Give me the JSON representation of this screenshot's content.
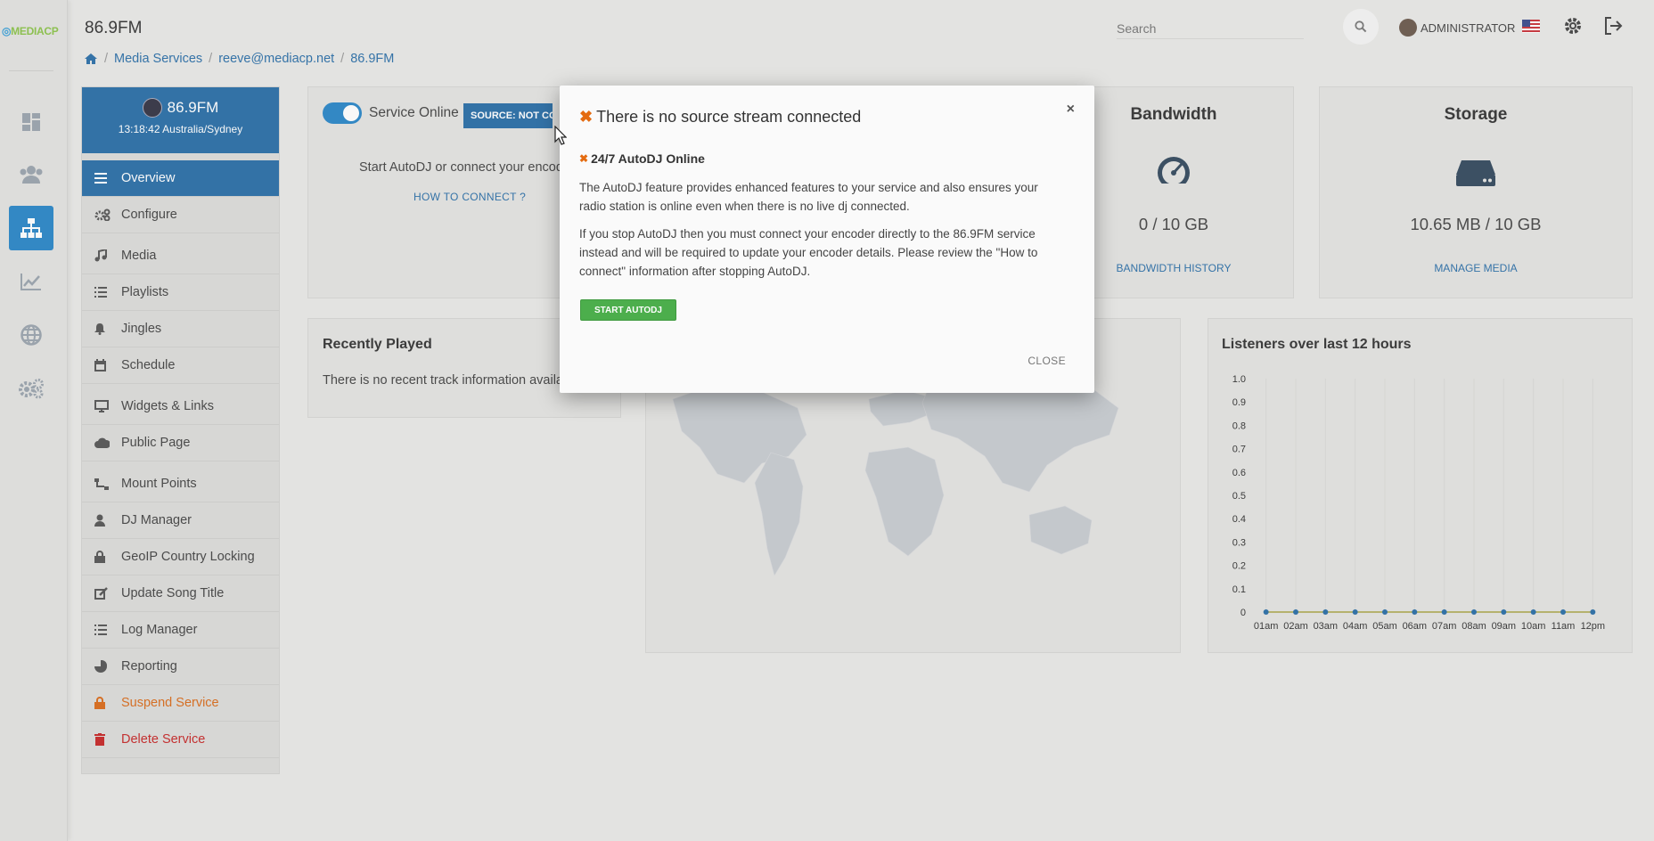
{
  "app": {
    "logo_text": "MEDIACP"
  },
  "header": {
    "title": "86.9FM",
    "search_placeholder": "Search",
    "user_label": "ADMINISTRATOR"
  },
  "breadcrumb": [
    "Media Services",
    "reeve@mediacp.net",
    "86.9FM"
  ],
  "sidebar": {
    "station_name": "86.9FM",
    "station_time": "13:18:42 Australia/Sydney",
    "items": [
      {
        "label": "Overview",
        "icon": "menu-icon"
      },
      {
        "label": "Configure",
        "icon": "gears-icon"
      },
      {
        "label": "Media",
        "icon": "music-icon"
      },
      {
        "label": "Playlists",
        "icon": "list-icon"
      },
      {
        "label": "Jingles",
        "icon": "bell-icon"
      },
      {
        "label": "Schedule",
        "icon": "calendar-icon"
      },
      {
        "label": "Widgets & Links",
        "icon": "monitor-icon"
      },
      {
        "label": "Public Page",
        "icon": "cloud-icon"
      },
      {
        "label": "Mount Points",
        "icon": "sitemap-icon"
      },
      {
        "label": "DJ Manager",
        "icon": "user-icon"
      },
      {
        "label": "GeoIP Country Locking",
        "icon": "lock-icon"
      },
      {
        "label": "Update Song Title",
        "icon": "edit-icon"
      },
      {
        "label": "Log Manager",
        "icon": "list-icon"
      },
      {
        "label": "Reporting",
        "icon": "pie-chart-icon"
      },
      {
        "label": "Suspend Service",
        "icon": "lock-icon"
      },
      {
        "label": "Delete Service",
        "icon": "trash-icon"
      }
    ]
  },
  "status_card": {
    "service_label": "Service Online",
    "source_badge": "SOURCE: NOT CONNECTED",
    "start_text": "Start AutoDJ or connect your encoder",
    "how_link": "HOW TO CONNECT ?"
  },
  "bandwidth": {
    "title": "Bandwidth",
    "value": "0 / 10 GB",
    "link": "BANDWIDTH HISTORY"
  },
  "storage": {
    "title": "Storage",
    "value": "10.65 MB / 10 GB",
    "link": "MANAGE MEDIA"
  },
  "recently_played": {
    "title": "Recently Played",
    "empty_text": "There is no recent track information available"
  },
  "listeners": {
    "title": "Listeners over last 12 hours"
  },
  "chart_data": {
    "type": "line",
    "title": "Listeners over last 12 hours",
    "x": [
      "01am",
      "02am",
      "03am",
      "04am",
      "05am",
      "06am",
      "07am",
      "08am",
      "09am",
      "10am",
      "11am",
      "12pm"
    ],
    "series": [
      {
        "values": [
          0,
          0,
          0,
          0,
          0,
          0,
          0,
          0,
          0,
          0,
          0,
          0
        ]
      }
    ],
    "yticks": [
      "0",
      "0.1",
      "0.2",
      "0.3",
      "0.4",
      "0.5",
      "0.6",
      "0.7",
      "0.8",
      "0.9",
      "1.0"
    ],
    "ylim": [
      0,
      1
    ],
    "grid": "vertical",
    "colors": {
      "line": "#b7b46a",
      "point": "#2a6ea7",
      "grid": "#d9d9d6"
    }
  },
  "modal": {
    "title": "There is no source stream connected",
    "close_x": "×",
    "subtitle": "24/7 AutoDJ Online",
    "para1": "The AutoDJ feature provides enhanced features to your service and also ensures your radio station is online even when there is no live dj connected.",
    "para2": "If you stop AutoDJ then you must connect your encoder directly to the 86.9FM service instead and will be required to update your encoder details. Please review the \"How to connect\" information after stopping AutoDJ.",
    "start_button": "START AUTODJ",
    "close_button": "CLOSE"
  },
  "colors": {
    "accent": "#2a6ea7",
    "warning": "#d96b1b",
    "danger": "#c62828",
    "success": "#4cae4c"
  }
}
